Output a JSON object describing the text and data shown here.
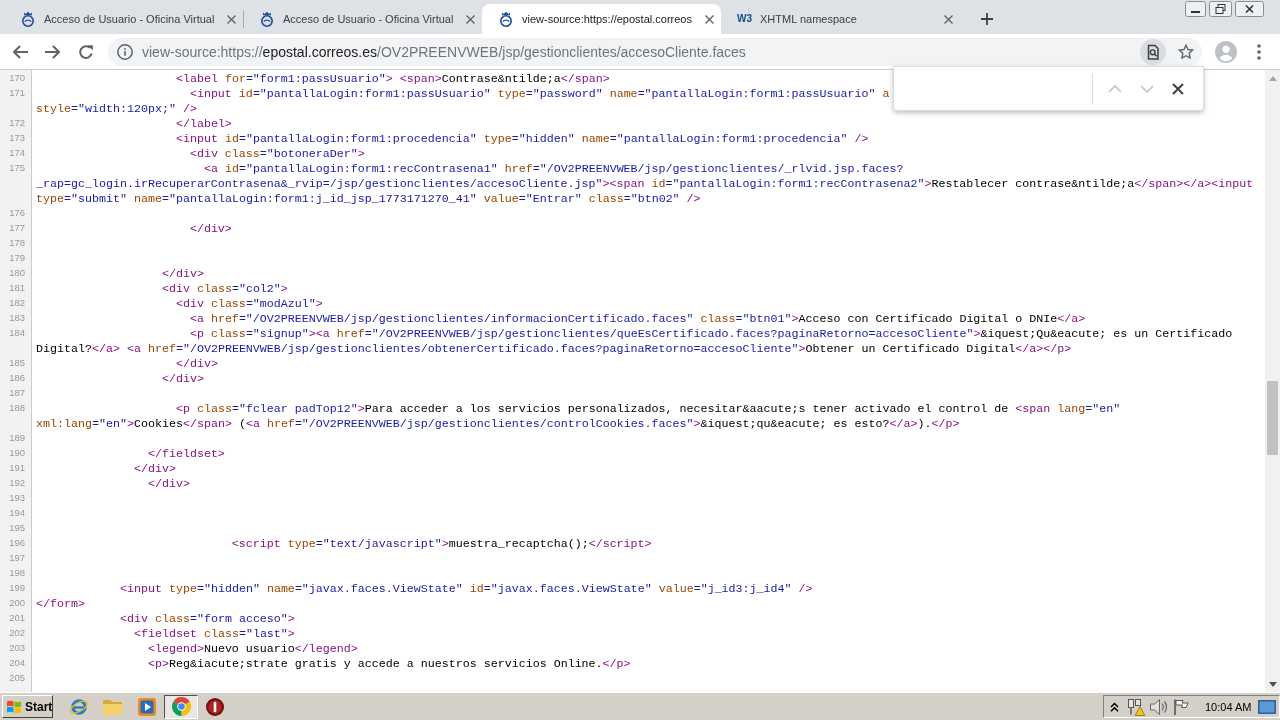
{
  "tabs": [
    {
      "title": "Acceso de Usuario - Oficina Virtual",
      "selected": false,
      "icon": {
        "kind": "emblem"
      }
    },
    {
      "title": "Acceso de Usuario - Oficina Virtual",
      "selected": false,
      "icon": {
        "kind": "emblem"
      }
    },
    {
      "title": "view-source:https://epostal.correos",
      "selected": true,
      "icon": {
        "kind": "emblem"
      }
    },
    {
      "title": "XHTML namespace",
      "selected": false,
      "icon": {
        "kind": "lettermark",
        "text": "W3"
      }
    }
  ],
  "address_bar": {
    "scheme": "view-source:https://",
    "host": "epostal.correos.es",
    "path": "/OV2PREENVWEB/jsp/gestionclientes/accesoCliente.faces",
    "find_active": true
  },
  "find_bar": {
    "buttons": [
      {
        "kind": "previous",
        "disabled": true
      },
      {
        "kind": "next",
        "disabled": true
      },
      {
        "kind": "close",
        "disabled": false
      }
    ]
  },
  "source": {
    "lines": [
      {
        "number": "170",
        "parts": [
          {
            "tokens": [
              {
                "kind": "tag",
                "text": "                    <label"
              },
              {
                "kind": "attr",
                "text": " for"
              },
              {
                "kind": "value",
                "text": "=\"form1:passUsuario\""
              },
              {
                "kind": "tag",
                "text": "> <span>"
              },
              {
                "kind": "text",
                "text": "Contrase&ntilde;a"
              },
              {
                "kind": "tag",
                "text": "</span>"
              }
            ]
          }
        ]
      },
      {
        "number": "171",
        "parts": [
          {
            "tokens": [
              {
                "kind": "tag",
                "text": "                      <input"
              },
              {
                "kind": "attr",
                "text": " id"
              },
              {
                "kind": "value",
                "text": "=\"pantallaLogin:form1:passUsuario\""
              },
              {
                "kind": "attr",
                "text": " type"
              },
              {
                "kind": "value",
                "text": "=\"password\""
              },
              {
                "kind": "attr",
                "text": " name"
              },
              {
                "kind": "value",
                "text": "=\"pantallaLogin:form1:passUsuario\""
              },
              {
                "kind": "attr",
                "text": " a"
              }
            ]
          },
          {
            "tokens": [
              {
                "kind": "attr",
                "text": "style"
              },
              {
                "kind": "value",
                "text": "=\"width:120px;\""
              },
              {
                "kind": "tag",
                "text": " />"
              }
            ]
          }
        ]
      },
      {
        "number": "172",
        "parts": [
          {
            "tokens": [
              {
                "kind": "tag",
                "text": "                    </label>"
              }
            ]
          }
        ]
      },
      {
        "number": "173",
        "parts": [
          {
            "tokens": [
              {
                "kind": "tag",
                "text": "                    <input"
              },
              {
                "kind": "attr",
                "text": " id"
              },
              {
                "kind": "value",
                "text": "=\"pantallaLogin:form1:procedencia\""
              },
              {
                "kind": "attr",
                "text": " type"
              },
              {
                "kind": "value",
                "text": "=\"hidden\""
              },
              {
                "kind": "attr",
                "text": " name"
              },
              {
                "kind": "value",
                "text": "=\"pantallaLogin:form1:procedencia\""
              },
              {
                "kind": "tag",
                "text": " />"
              }
            ]
          }
        ]
      },
      {
        "number": "174",
        "parts": [
          {
            "tokens": [
              {
                "kind": "tag",
                "text": "                      <div"
              },
              {
                "kind": "attr",
                "text": " class"
              },
              {
                "kind": "value",
                "text": "=\"botoneraDer\""
              },
              {
                "kind": "tag",
                "text": ">"
              }
            ]
          }
        ]
      },
      {
        "number": "175",
        "parts": [
          {
            "tokens": [
              {
                "kind": "tag",
                "text": "                        <a"
              },
              {
                "kind": "attr",
                "text": " id"
              },
              {
                "kind": "value",
                "text": "=\"pantallaLogin:form1:recContrasena1\""
              },
              {
                "kind": "attr",
                "text": " href"
              },
              {
                "kind": "value",
                "text": "=\"/OV2PREENVWEB/jsp/gestionclientes/_rlvid.jsp.faces?"
              }
            ]
          },
          {
            "tokens": [
              {
                "kind": "value",
                "text": "_rap=gc_login.irRecuperarContrasena&_rvip=/jsp/gestionclientes/accesoCliente.jsp\""
              },
              {
                "kind": "tag",
                "text": "><span"
              },
              {
                "kind": "attr",
                "text": " id"
              },
              {
                "kind": "value",
                "text": "=\"pantallaLogin:form1:recContrasena2\""
              },
              {
                "kind": "tag",
                "text": ">"
              },
              {
                "kind": "text",
                "text": "Restablecer contrase&ntilde;a"
              },
              {
                "kind": "tag",
                "text": "</span></a><input"
              }
            ]
          },
          {
            "tokens": [
              {
                "kind": "attr",
                "text": "type"
              },
              {
                "kind": "value",
                "text": "=\"submit\""
              },
              {
                "kind": "attr",
                "text": " name"
              },
              {
                "kind": "value",
                "text": "=\"pantallaLogin:form1:j_id_jsp_1773171270_41\""
              },
              {
                "kind": "attr",
                "text": " value"
              },
              {
                "kind": "value",
                "text": "=\"Entrar\""
              },
              {
                "kind": "attr",
                "text": " class"
              },
              {
                "kind": "value",
                "text": "=\"btn02\""
              },
              {
                "kind": "tag",
                "text": " />"
              }
            ]
          }
        ]
      },
      {
        "number": "176"
      },
      {
        "number": "177",
        "parts": [
          {
            "tokens": [
              {
                "kind": "tag",
                "text": "                      </div>"
              }
            ]
          }
        ]
      },
      {
        "number": "178"
      },
      {
        "number": "179"
      },
      {
        "number": "180",
        "parts": [
          {
            "tokens": [
              {
                "kind": "tag",
                "text": "                  </div>"
              }
            ]
          }
        ]
      },
      {
        "number": "181",
        "parts": [
          {
            "tokens": [
              {
                "kind": "tag",
                "text": "                  <div"
              },
              {
                "kind": "attr",
                "text": " class"
              },
              {
                "kind": "value",
                "text": "=\"col2\""
              },
              {
                "kind": "tag",
                "text": ">"
              }
            ]
          }
        ]
      },
      {
        "number": "182",
        "parts": [
          {
            "tokens": [
              {
                "kind": "tag",
                "text": "                    <div"
              },
              {
                "kind": "attr",
                "text": " class"
              },
              {
                "kind": "value",
                "text": "=\"modAzul\""
              },
              {
                "kind": "tag",
                "text": ">"
              }
            ]
          }
        ]
      },
      {
        "number": "183",
        "parts": [
          {
            "tokens": [
              {
                "kind": "tag",
                "text": "                      <a"
              },
              {
                "kind": "attr",
                "text": " href"
              },
              {
                "kind": "value",
                "text": "=\"/OV2PREENVWEB/jsp/gestionclientes/informacionCertificado.faces\""
              },
              {
                "kind": "attr",
                "text": " class"
              },
              {
                "kind": "value",
                "text": "=\"btn01\""
              },
              {
                "kind": "tag",
                "text": ">"
              },
              {
                "kind": "text",
                "text": "Acceso con Certificado Digital o DNIe"
              },
              {
                "kind": "tag",
                "text": "</a>"
              }
            ]
          }
        ]
      },
      {
        "number": "184",
        "parts": [
          {
            "tokens": [
              {
                "kind": "tag",
                "text": "                      <p"
              },
              {
                "kind": "attr",
                "text": " class"
              },
              {
                "kind": "value",
                "text": "=\"signup\""
              },
              {
                "kind": "tag",
                "text": "><a"
              },
              {
                "kind": "attr",
                "text": " href"
              },
              {
                "kind": "value",
                "text": "=\"/OV2PREENVWEB/jsp/gestionclientes/queEsCertificado.faces?paginaRetorno=accesoCliente\""
              },
              {
                "kind": "tag",
                "text": ">"
              },
              {
                "kind": "text",
                "text": "&iquest;Qu&eacute; es un Certificado"
              }
            ]
          },
          {
            "tokens": [
              {
                "kind": "text",
                "text": "Digital?"
              },
              {
                "kind": "tag",
                "text": "</a> <a"
              },
              {
                "kind": "attr",
                "text": " href"
              },
              {
                "kind": "value",
                "text": "=\"/OV2PREENVWEB/jsp/gestionclientes/obtenerCertificado.faces?paginaRetorno=accesoCliente\""
              },
              {
                "kind": "tag",
                "text": ">"
              },
              {
                "kind": "text",
                "text": "Obtener un Certificado Digital"
              },
              {
                "kind": "tag",
                "text": "</a></p>"
              }
            ]
          }
        ]
      },
      {
        "number": "185",
        "parts": [
          {
            "tokens": [
              {
                "kind": "tag",
                "text": "                    </div>"
              }
            ]
          }
        ]
      },
      {
        "number": "186",
        "parts": [
          {
            "tokens": [
              {
                "kind": "tag",
                "text": "                  </div>"
              }
            ]
          }
        ]
      },
      {
        "number": "187"
      },
      {
        "number": "188",
        "parts": [
          {
            "tokens": [
              {
                "kind": "tag",
                "text": "                    <p"
              },
              {
                "kind": "attr",
                "text": " class"
              },
              {
                "kind": "value",
                "text": "=\"fclear padTop12\""
              },
              {
                "kind": "tag",
                "text": ">"
              },
              {
                "kind": "text",
                "text": "Para acceder a los servicios personalizados, necesitar&aacute;s tener activado el control de "
              },
              {
                "kind": "tag",
                "text": "<span"
              },
              {
                "kind": "attr",
                "text": " lang"
              },
              {
                "kind": "value",
                "text": "=\"en\""
              }
            ]
          },
          {
            "tokens": [
              {
                "kind": "attr",
                "text": "xml:lang"
              },
              {
                "kind": "value",
                "text": "=\"en\""
              },
              {
                "kind": "tag",
                "text": ">"
              },
              {
                "kind": "text",
                "text": "Cookies"
              },
              {
                "kind": "tag",
                "text": "</span>"
              },
              {
                "kind": "text",
                "text": " ("
              },
              {
                "kind": "tag",
                "text": "<a"
              },
              {
                "kind": "attr",
                "text": " href"
              },
              {
                "kind": "value",
                "text": "=\"/OV2PREENVWEB/jsp/gestionclientes/controlCookies.faces\""
              },
              {
                "kind": "tag",
                "text": ">"
              },
              {
                "kind": "text",
                "text": "&iquest;qu&eacute; es esto?"
              },
              {
                "kind": "tag",
                "text": "</a>"
              },
              {
                "kind": "text",
                "text": ")."
              },
              {
                "kind": "tag",
                "text": "</p>"
              }
            ]
          }
        ]
      },
      {
        "number": "189"
      },
      {
        "number": "190",
        "parts": [
          {
            "tokens": [
              {
                "kind": "tag",
                "text": "                </fieldset>"
              }
            ]
          }
        ]
      },
      {
        "number": "191",
        "parts": [
          {
            "tokens": [
              {
                "kind": "tag",
                "text": "              </div>"
              }
            ]
          }
        ]
      },
      {
        "number": "192",
        "parts": [
          {
            "tokens": [
              {
                "kind": "tag",
                "text": "                </div>"
              }
            ]
          }
        ]
      },
      {
        "number": "193"
      },
      {
        "number": "194"
      },
      {
        "number": "195"
      },
      {
        "number": "196",
        "parts": [
          {
            "tokens": [
              {
                "kind": "tag",
                "text": "                            <script"
              },
              {
                "kind": "attr",
                "text": " type"
              },
              {
                "kind": "value",
                "text": "=\"text/javascript\""
              },
              {
                "kind": "tag",
                "text": ">"
              },
              {
                "kind": "text",
                "text": "muestra_recaptcha();"
              },
              {
                "kind": "tag",
                "text": "</script>"
              }
            ]
          }
        ]
      },
      {
        "number": "197"
      },
      {
        "number": "198"
      },
      {
        "number": "199",
        "parts": [
          {
            "tokens": [
              {
                "kind": "tag",
                "text": "            <input"
              },
              {
                "kind": "attr",
                "text": " type"
              },
              {
                "kind": "value",
                "text": "=\"hidden\""
              },
              {
                "kind": "attr",
                "text": " name"
              },
              {
                "kind": "value",
                "text": "=\"javax.faces.ViewState\""
              },
              {
                "kind": "attr",
                "text": " id"
              },
              {
                "kind": "value",
                "text": "=\"javax.faces.ViewState\""
              },
              {
                "kind": "attr",
                "text": " value"
              },
              {
                "kind": "value",
                "text": "=\"j_id3:j_id4\""
              },
              {
                "kind": "tag",
                "text": " />"
              }
            ]
          }
        ]
      },
      {
        "number": "200",
        "parts": [
          {
            "tokens": [
              {
                "kind": "tag",
                "text": "</form>"
              }
            ]
          }
        ]
      },
      {
        "number": "201",
        "parts": [
          {
            "tokens": [
              {
                "kind": "tag",
                "text": "            <div"
              },
              {
                "kind": "attr",
                "text": " class"
              },
              {
                "kind": "value",
                "text": "=\"form acceso\""
              },
              {
                "kind": "tag",
                "text": ">"
              }
            ]
          }
        ]
      },
      {
        "number": "202",
        "parts": [
          {
            "tokens": [
              {
                "kind": "tag",
                "text": "              <fieldset"
              },
              {
                "kind": "attr",
                "text": " class"
              },
              {
                "kind": "value",
                "text": "=\"last\""
              },
              {
                "kind": "tag",
                "text": ">"
              }
            ]
          }
        ]
      },
      {
        "number": "203",
        "parts": [
          {
            "tokens": [
              {
                "kind": "tag",
                "text": "                <legend>"
              },
              {
                "kind": "text",
                "text": "Nuevo usuario"
              },
              {
                "kind": "tag",
                "text": "</legend>"
              }
            ]
          }
        ]
      },
      {
        "number": "204",
        "parts": [
          {
            "tokens": [
              {
                "kind": "tag",
                "text": "                <p>"
              },
              {
                "kind": "text",
                "text": "Reg&iacute;strate gratis y accede a nuestros servicios Online."
              },
              {
                "kind": "tag",
                "text": "</p>"
              }
            ]
          }
        ]
      },
      {
        "number": "205"
      }
    ]
  },
  "taskbar": {
    "start": "Start",
    "apps": [
      {
        "kind": "browser",
        "selected": false
      },
      {
        "kind": "folder",
        "selected": false
      },
      {
        "kind": "player",
        "selected": false
      },
      {
        "kind": "roundlogo",
        "selected": true
      },
      {
        "kind": "alert",
        "selected": false
      }
    ],
    "clock": "10:04 AM"
  }
}
